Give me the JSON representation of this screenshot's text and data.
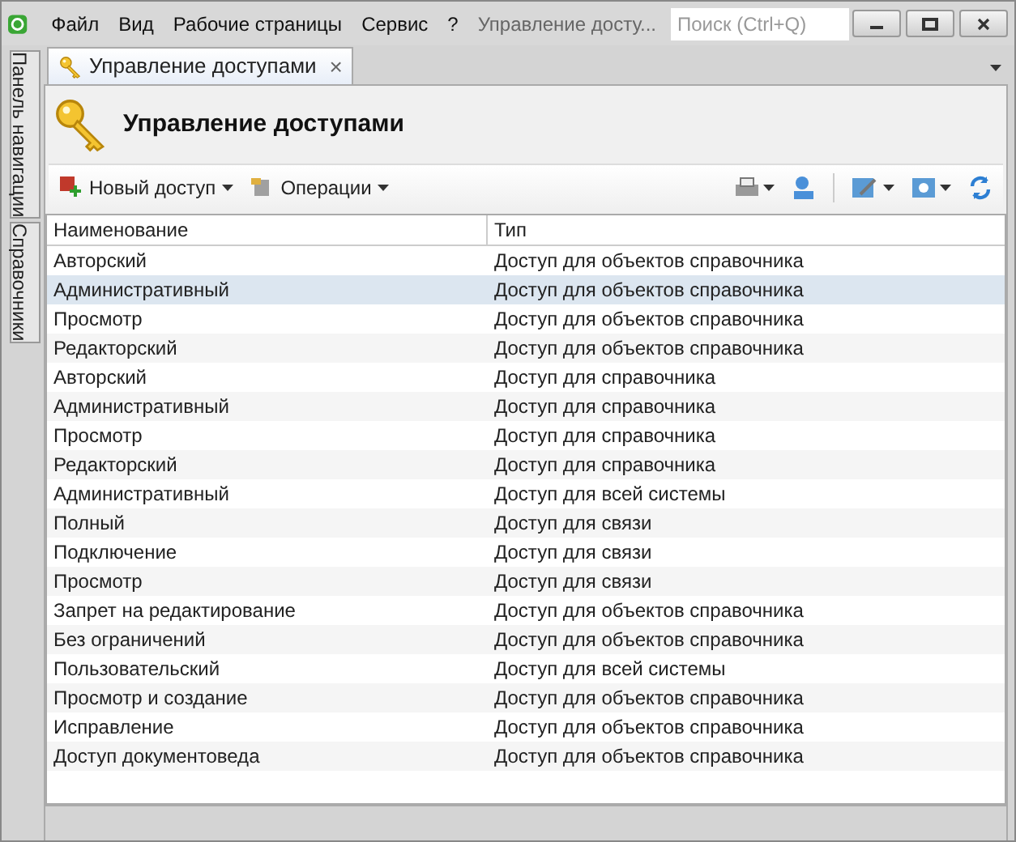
{
  "menu": [
    {
      "label": "Файл"
    },
    {
      "label": "Вид"
    },
    {
      "label": "Рабочие страницы"
    },
    {
      "label": "Сервис"
    },
    {
      "label": "?"
    }
  ],
  "window": {
    "title": "Управление досту..."
  },
  "search": {
    "placeholder": "Поиск (Ctrl+Q)"
  },
  "side_tabs": [
    {
      "label": "Панель навигации",
      "selected": false
    },
    {
      "label": "Справочники",
      "selected": false
    }
  ],
  "doc_tabs": [
    {
      "label": "Управление доступами",
      "close": "×",
      "selected": true
    }
  ],
  "page": {
    "title": "Управление доступами"
  },
  "toolbar": [
    {
      "label": "Новый доступ",
      "kind": "new"
    },
    {
      "label": "Операции",
      "kind": "ops"
    }
  ],
  "table": {
    "columns": [
      "Наименование",
      "Тип"
    ],
    "rows": [
      {
        "cells": [
          "Авторский",
          "Доступ для объектов справочника"
        ],
        "selected": false
      },
      {
        "cells": [
          "Административный",
          "Доступ для объектов справочника"
        ],
        "selected": true
      },
      {
        "cells": [
          "Просмотр",
          "Доступ для объектов справочника"
        ],
        "selected": false
      },
      {
        "cells": [
          "Редакторский",
          "Доступ для объектов справочника"
        ],
        "selected": false
      },
      {
        "cells": [
          "Авторский",
          "Доступ для справочника"
        ],
        "selected": false
      },
      {
        "cells": [
          "Административный",
          "Доступ для справочника"
        ],
        "selected": false
      },
      {
        "cells": [
          "Просмотр",
          "Доступ для справочника"
        ],
        "selected": false
      },
      {
        "cells": [
          "Редакторский",
          "Доступ для справочника"
        ],
        "selected": false
      },
      {
        "cells": [
          "Административный",
          "Доступ для всей системы"
        ],
        "selected": false
      },
      {
        "cells": [
          "Полный",
          "Доступ для связи"
        ],
        "selected": false
      },
      {
        "cells": [
          "Подключение",
          "Доступ для связи"
        ],
        "selected": false
      },
      {
        "cells": [
          "Просмотр",
          "Доступ для связи"
        ],
        "selected": false
      },
      {
        "cells": [
          "Запрет на редактирование",
          "Доступ для объектов справочника"
        ],
        "selected": false
      },
      {
        "cells": [
          "Без ограничений",
          "Доступ для объектов справочника"
        ],
        "selected": false
      },
      {
        "cells": [
          "Пользовательский",
          "Доступ для всей системы"
        ],
        "selected": false
      },
      {
        "cells": [
          "Просмотр и создание",
          "Доступ для объектов справочника"
        ],
        "selected": false
      },
      {
        "cells": [
          "Исправление",
          "Доступ для объектов справочника"
        ],
        "selected": false
      },
      {
        "cells": [
          "Доступ документоведа",
          "Доступ для объектов справочника"
        ],
        "selected": false
      }
    ]
  }
}
